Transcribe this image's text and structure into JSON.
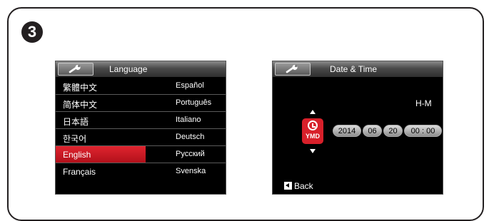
{
  "step_number": "3",
  "left_screen": {
    "title": "Language",
    "icon": "wrench-icon",
    "highlight_color": "#d8202a",
    "rows": [
      {
        "col1": "繁體中文",
        "col2": "Español"
      },
      {
        "col1": "简体中文",
        "col2": "Português"
      },
      {
        "col1": "日本語",
        "col2": "Italiano"
      },
      {
        "col1": "한국어",
        "col2": "Deutsch"
      },
      {
        "col1": "English",
        "col2": "Русский",
        "selected": true
      },
      {
        "col1": "Français",
        "col2": "Svenska"
      }
    ]
  },
  "right_screen": {
    "title": "Date & Time",
    "icon": "wrench-icon",
    "format_label": "H-M",
    "date_icon": {
      "name": "ymd-clock-icon",
      "label": "YMD"
    },
    "fields": {
      "year": "2014",
      "month": "06",
      "day": "20",
      "time": "00 : 00"
    },
    "back_label": "Back"
  }
}
